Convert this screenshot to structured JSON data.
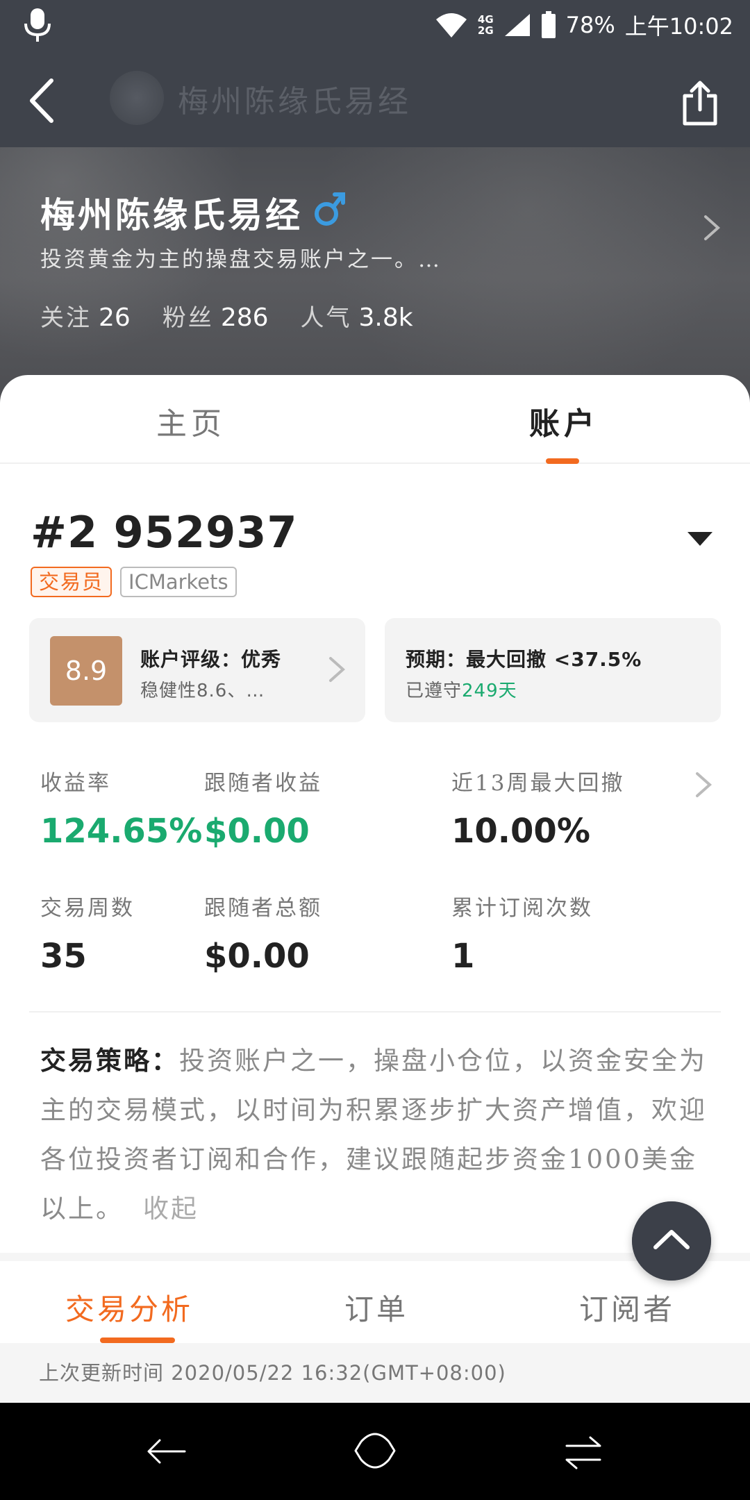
{
  "status_bar": {
    "network": "4G\n2G",
    "battery": "78%",
    "time": "上午10:02"
  },
  "nav": {
    "title": "梅州陈缘氏易经"
  },
  "profile": {
    "name": "梅州陈缘氏易经",
    "description": "投资黄金为主的操盘交易账户之一。…",
    "stats": [
      {
        "label": "关注",
        "value": "26"
      },
      {
        "label": "粉丝",
        "value": "286"
      },
      {
        "label": "人气",
        "value": "3.8k"
      }
    ]
  },
  "tabs": {
    "home": "主页",
    "account": "账户"
  },
  "account": {
    "id": "#2 952937",
    "tag_role": "交易员",
    "tag_broker": "ICMarkets",
    "rating_score": "8.9",
    "rating_title": "账户评级：优秀",
    "rating_sub": "稳健性8.6、…",
    "expect_title": "预期：最大回撤 <37.5%",
    "expect_sub_prefix": "已遵守",
    "expect_sub_days": "249天"
  },
  "metrics": [
    {
      "label": "收益率",
      "value": "124.65%"
    },
    {
      "label": "跟随者收益",
      "value": "$0.00"
    },
    {
      "label": "近13周最大回撤",
      "value": "10.00%"
    },
    {
      "label": "交易周数",
      "value": "35"
    },
    {
      "label": "跟随者总额",
      "value": "$0.00"
    },
    {
      "label": "累计订阅次数",
      "value": "1"
    }
  ],
  "strategy": {
    "label": "交易策略：",
    "text": "投资账户之一，操盘小仓位，以资金安全为主的交易模式，以时间为积累逐步扩大资产增值，欢迎各位投资者订阅和合作，建议跟随起步资金1000美金以上。",
    "collapse": "收起"
  },
  "subtabs": {
    "analysis": "交易分析",
    "orders": "订单",
    "subscribers": "订阅者"
  },
  "update": {
    "text": "上次更新时间 2020/05/22 16:32(GMT+08:00)"
  },
  "colors": {
    "accent": "#f26a1f",
    "positive": "#1aaa6f",
    "header": "#3f434b",
    "score": "#c4916b"
  }
}
